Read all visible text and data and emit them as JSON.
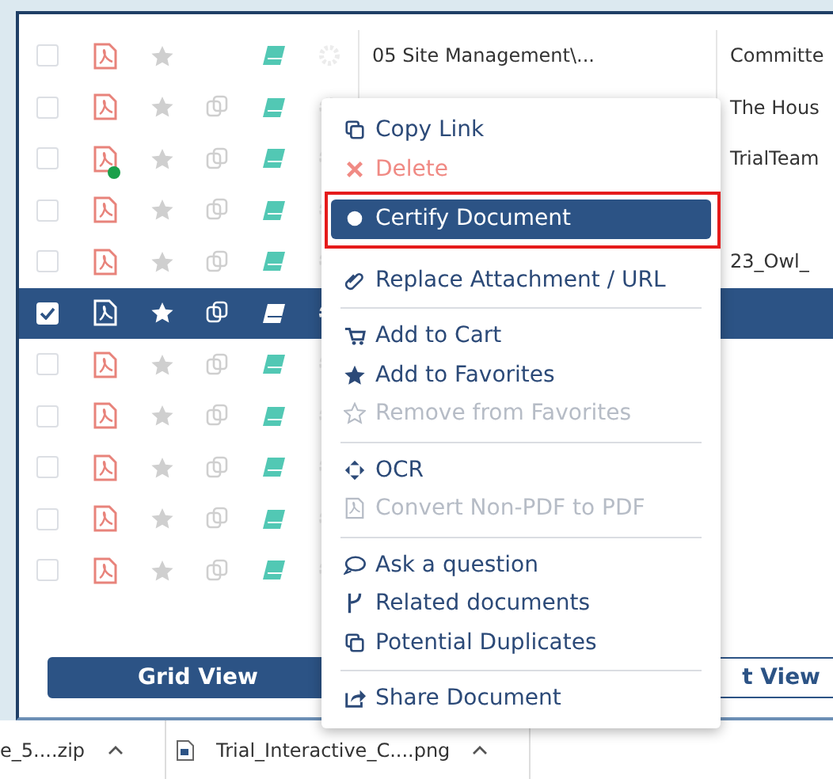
{
  "rows": [
    {
      "checked": false,
      "selected": false,
      "dot": false,
      "duplicates": false,
      "column_2": "05 Site Management\\...",
      "column_3": "Committe"
    },
    {
      "checked": false,
      "selected": false,
      "dot": false,
      "duplicates": true,
      "column_3": "The Hous"
    },
    {
      "checked": false,
      "selected": false,
      "dot": true,
      "duplicates": true,
      "column_3": "TrialTeam"
    },
    {
      "checked": false,
      "selected": false,
      "dot": false,
      "duplicates": true
    },
    {
      "checked": false,
      "selected": false,
      "dot": false,
      "duplicates": true,
      "column_3": "23_Owl_"
    },
    {
      "checked": true,
      "selected": true,
      "dot": false,
      "duplicates": true
    },
    {
      "checked": false,
      "selected": false,
      "dot": false,
      "duplicates": true
    },
    {
      "checked": false,
      "selected": false,
      "dot": false,
      "duplicates": true
    },
    {
      "checked": false,
      "selected": false,
      "dot": false,
      "duplicates": true
    },
    {
      "checked": false,
      "selected": false,
      "dot": false,
      "duplicates": true
    },
    {
      "checked": false,
      "selected": false,
      "dot": false,
      "duplicates": true
    }
  ],
  "buttons": [
    {
      "label": "Grid View",
      "selected": true
    },
    {
      "label": "t View",
      "selected": false
    }
  ],
  "context_menu": {
    "groups": [
      [
        {
          "label": "Copy Link",
          "kind": "normal",
          "selected": false,
          "annotated": false
        },
        {
          "label": "Delete",
          "kind": "danger",
          "selected": false,
          "annotated": false
        },
        {
          "label": "Certify Document",
          "kind": "normal",
          "selected": true,
          "annotated": true
        },
        {
          "label": "Replace Attachment / URL",
          "kind": "normal",
          "selected": false,
          "annotated": false
        }
      ],
      [
        {
          "label": "Add to Cart",
          "kind": "normal",
          "selected": false,
          "annotated": false
        },
        {
          "label": "Add to Favorites",
          "kind": "normal",
          "selected": false,
          "annotated": false
        },
        {
          "label": "Remove from Favorites",
          "kind": "disabled",
          "selected": false,
          "annotated": false
        }
      ],
      [
        {
          "label": "OCR",
          "kind": "normal",
          "selected": false,
          "annotated": false
        },
        {
          "label": "Convert Non-PDF to PDF",
          "kind": "disabled",
          "selected": false,
          "annotated": false
        }
      ],
      [
        {
          "label": "Ask a question",
          "kind": "normal",
          "selected": false,
          "annotated": false
        },
        {
          "label": "Related documents",
          "kind": "normal",
          "selected": false,
          "annotated": false
        },
        {
          "label": "Potential Duplicates",
          "kind": "normal",
          "selected": false,
          "annotated": false
        }
      ],
      [
        {
          "label": "Share Document",
          "kind": "normal",
          "selected": false,
          "annotated": false
        }
      ]
    ]
  },
  "downloads": [
    {
      "name": "e_5....zip",
      "file_icon": false
    },
    {
      "name": "Trial_Interactive_C....png",
      "file_icon": true
    }
  ]
}
